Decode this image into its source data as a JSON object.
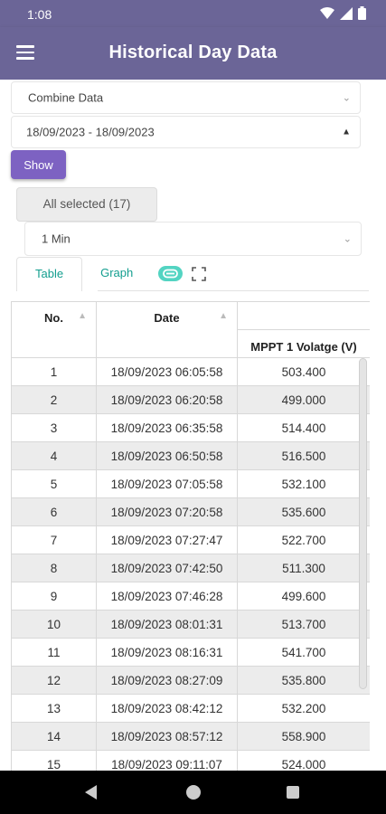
{
  "status": {
    "time": "1:08"
  },
  "appbar": {
    "title": "Historical Day Data"
  },
  "filters": {
    "data_type": "Combine Data",
    "date_range": "18/09/2023 - 18/09/2023",
    "show_label": "Show",
    "selection": "All selected (17)",
    "interval": "1 Min"
  },
  "tabs": [
    {
      "label": "Table"
    },
    {
      "label": "Graph"
    }
  ],
  "table": {
    "headers": {
      "no": "No.",
      "date": "Date",
      "mppt": "MPPT 1 Volatge (V)"
    },
    "rows": [
      {
        "no": "1",
        "date": "18/09/2023 06:05:58",
        "value": "503.400"
      },
      {
        "no": "2",
        "date": "18/09/2023 06:20:58",
        "value": "499.000"
      },
      {
        "no": "3",
        "date": "18/09/2023 06:35:58",
        "value": "514.400"
      },
      {
        "no": "4",
        "date": "18/09/2023 06:50:58",
        "value": "516.500"
      },
      {
        "no": "5",
        "date": "18/09/2023 07:05:58",
        "value": "532.100"
      },
      {
        "no": "6",
        "date": "18/09/2023 07:20:58",
        "value": "535.600"
      },
      {
        "no": "7",
        "date": "18/09/2023 07:27:47",
        "value": "522.700"
      },
      {
        "no": "8",
        "date": "18/09/2023 07:42:50",
        "value": "511.300"
      },
      {
        "no": "9",
        "date": "18/09/2023 07:46:28",
        "value": "499.600"
      },
      {
        "no": "10",
        "date": "18/09/2023 08:01:31",
        "value": "513.700"
      },
      {
        "no": "11",
        "date": "18/09/2023 08:16:31",
        "value": "541.700"
      },
      {
        "no": "12",
        "date": "18/09/2023 08:27:09",
        "value": "535.800"
      },
      {
        "no": "13",
        "date": "18/09/2023 08:42:12",
        "value": "532.200"
      },
      {
        "no": "14",
        "date": "18/09/2023 08:57:12",
        "value": "558.900"
      },
      {
        "no": "15",
        "date": "18/09/2023 09:11:07",
        "value": "524.000"
      }
    ]
  },
  "icons": {
    "menu": "menu-icon",
    "link": "link-icon",
    "expand": "fullscreen-icon",
    "sort": "sort-arrow-icon"
  },
  "colors": {
    "appbar": "#6b6597",
    "accent": "#7d62c2",
    "tab_text": "#139e8f"
  }
}
